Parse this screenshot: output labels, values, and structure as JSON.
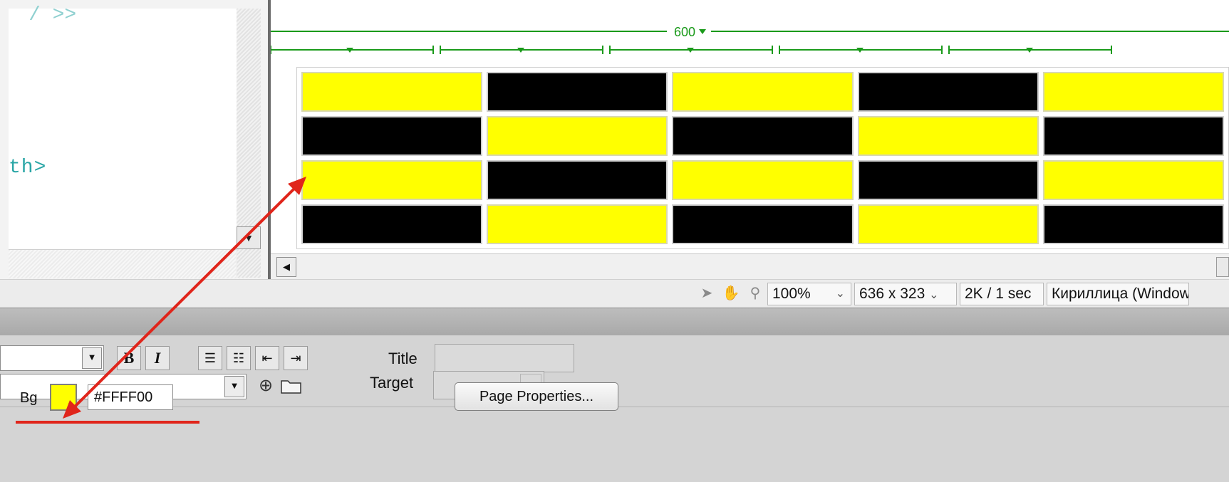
{
  "code_view": {
    "visible_text": "th>",
    "cut_text": "/ >>"
  },
  "design_view": {
    "width_label": "600",
    "table": {
      "rows": [
        [
          "yellow",
          "black",
          "yellow",
          "black",
          "yellow"
        ],
        [
          "black",
          "yellow",
          "black",
          "yellow",
          "black"
        ],
        [
          "yellow",
          "black",
          "yellow",
          "black",
          "yellow"
        ],
        [
          "black",
          "yellow",
          "black",
          "yellow",
          "black"
        ]
      ]
    }
  },
  "status_bar": {
    "zoom": "100%",
    "window_size": "636 x 323",
    "download": "2K / 1 sec",
    "encoding": "Кириллица (Windows)"
  },
  "properties": {
    "bold_label": "B",
    "italic_label": "I",
    "title_label": "Title",
    "target_label": "Target",
    "bg_label": "Bg",
    "bg_value": "#FFFF00",
    "page_properties_label": "Page Properties..."
  },
  "colors": {
    "cell_yellow": "#FFFF00",
    "cell_black": "#000000",
    "guide_green": "#1a9a1a",
    "annotation_red": "#e0251b"
  }
}
